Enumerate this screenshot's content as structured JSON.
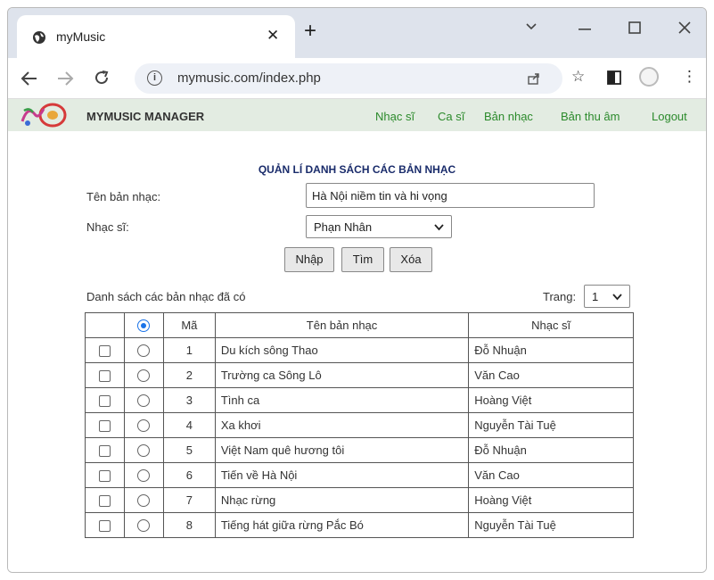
{
  "browser": {
    "tab_title": "myMusic",
    "url": "mymusic.com/index.php"
  },
  "app": {
    "name": "MYMUSIC MANAGER",
    "nav": [
      "Nhạc sĩ",
      "Ca sĩ",
      "Bản nhạc",
      "Bản thu âm",
      "Logout"
    ]
  },
  "form": {
    "title": "QUẢN LÍ DANH SÁCH CÁC BẢN NHẠC",
    "song_label": "Tên bản nhạc:",
    "song_value": "Hà Nội niềm tin và hi vọng",
    "composer_label": "Nhạc sĩ:",
    "composer_value": "Phạn Nhân",
    "buttons": {
      "add": "Nhập",
      "search": "Tìm",
      "delete": "Xóa"
    }
  },
  "list": {
    "caption": "Danh sách các bản nhạc đã có",
    "page_label": "Trang:",
    "page_value": "1",
    "columns": {
      "id": "Mã",
      "title": "Tên bản nhạc",
      "composer": "Nhạc sĩ"
    },
    "rows": [
      {
        "id": "1",
        "title": "Du kích sông Thao",
        "composer": "Đỗ Nhuận"
      },
      {
        "id": "2",
        "title": "Trường ca Sông Lô",
        "composer": "Văn Cao"
      },
      {
        "id": "3",
        "title": "Tình ca",
        "composer": "Hoàng Việt"
      },
      {
        "id": "4",
        "title": "Xa khơi",
        "composer": "Nguyễn Tài Tuệ"
      },
      {
        "id": "5",
        "title": "Việt Nam quê hương tôi",
        "composer": "Đỗ Nhuận"
      },
      {
        "id": "6",
        "title": "Tiến về Hà Nội",
        "composer": "Văn Cao"
      },
      {
        "id": "7",
        "title": "Nhạc rừng",
        "composer": "Hoàng Việt"
      },
      {
        "id": "8",
        "title": "Tiếng hát giữa rừng Pắc Bó",
        "composer": "Nguyễn Tài Tuệ"
      }
    ]
  },
  "colors": {
    "accent": "#2b8a2b",
    "title": "#1a2c6b",
    "appbar": "#e3ece2"
  }
}
